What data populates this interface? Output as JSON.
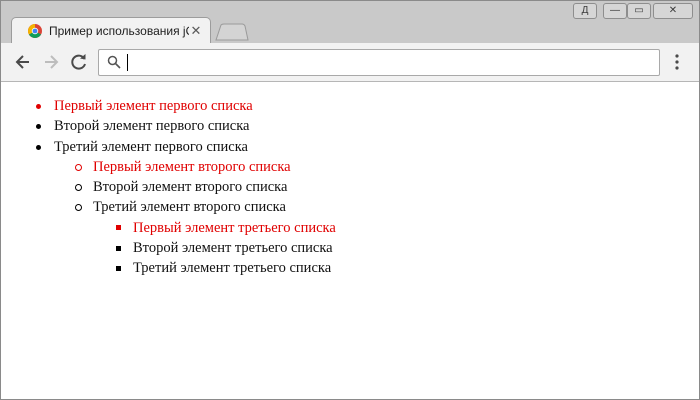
{
  "browser": {
    "tab": {
      "title": "Пример использования jQuery",
      "close_glyph": "✕",
      "favicon": "chrome-logo-icon"
    },
    "window_controls": {
      "user_glyph": "Д",
      "minimize_glyph": "—",
      "maximize_glyph": "▭",
      "close_glyph": "✕"
    },
    "omnibox": {
      "value": "",
      "placeholder": ""
    },
    "colors": {
      "frame": "#c9c9c9",
      "toolbar": "#f2f2f2",
      "highlight": "#e00000"
    }
  },
  "lists": {
    "first": [
      {
        "label": "Первый элемент первого списка",
        "color": "#e00000"
      },
      {
        "label": "Второй элемент первого списка",
        "color": "#000000"
      },
      {
        "label": "Третий элемент первого списка",
        "color": "#000000"
      }
    ],
    "second": [
      {
        "label": "Первый элемент второго списка",
        "color": "#e00000"
      },
      {
        "label": "Второй элемент второго списка",
        "color": "#000000"
      },
      {
        "label": "Третий элемент второго списка",
        "color": "#000000"
      }
    ],
    "third": [
      {
        "label": "Первый элемент третьего списка",
        "color": "#e00000"
      },
      {
        "label": "Второй элемент третьего списка",
        "color": "#000000"
      },
      {
        "label": "Третий элемент третьего списка",
        "color": "#000000"
      }
    ]
  }
}
